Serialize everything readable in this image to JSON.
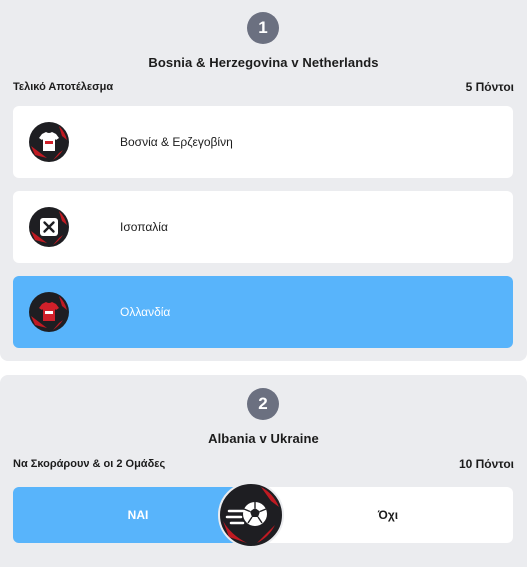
{
  "colors": {
    "card_bg": "#ebecef",
    "badge": "#6b7080",
    "selected": "#58b4fb",
    "icon_red": "#d0202a",
    "icon_dark": "#1e1e22"
  },
  "question1": {
    "number": "1",
    "match": "Bosnia & Herzegovina v Netherlands",
    "label": "Τελικό Αποτέλεσμα",
    "points": "5 Πόντοι",
    "options": [
      {
        "label": "Βοσνία & Ερζεγοβίνη",
        "icon": "shirt-icon",
        "selected": false
      },
      {
        "label": "Ισοπαλία",
        "icon": "draw-x-icon",
        "selected": false
      },
      {
        "label": "Ολλανδία",
        "icon": "shirt-icon",
        "selected": true
      }
    ]
  },
  "question2": {
    "number": "2",
    "match": "Albania v Ukraine",
    "label": "Να Σκοράρουν & οι 2 Ομάδες",
    "points": "10 Πόντοι",
    "yes_label": "ΝΑΙ",
    "no_label": "Όχι",
    "selected": "yes",
    "center_icon": "soccer-ball-icon"
  }
}
